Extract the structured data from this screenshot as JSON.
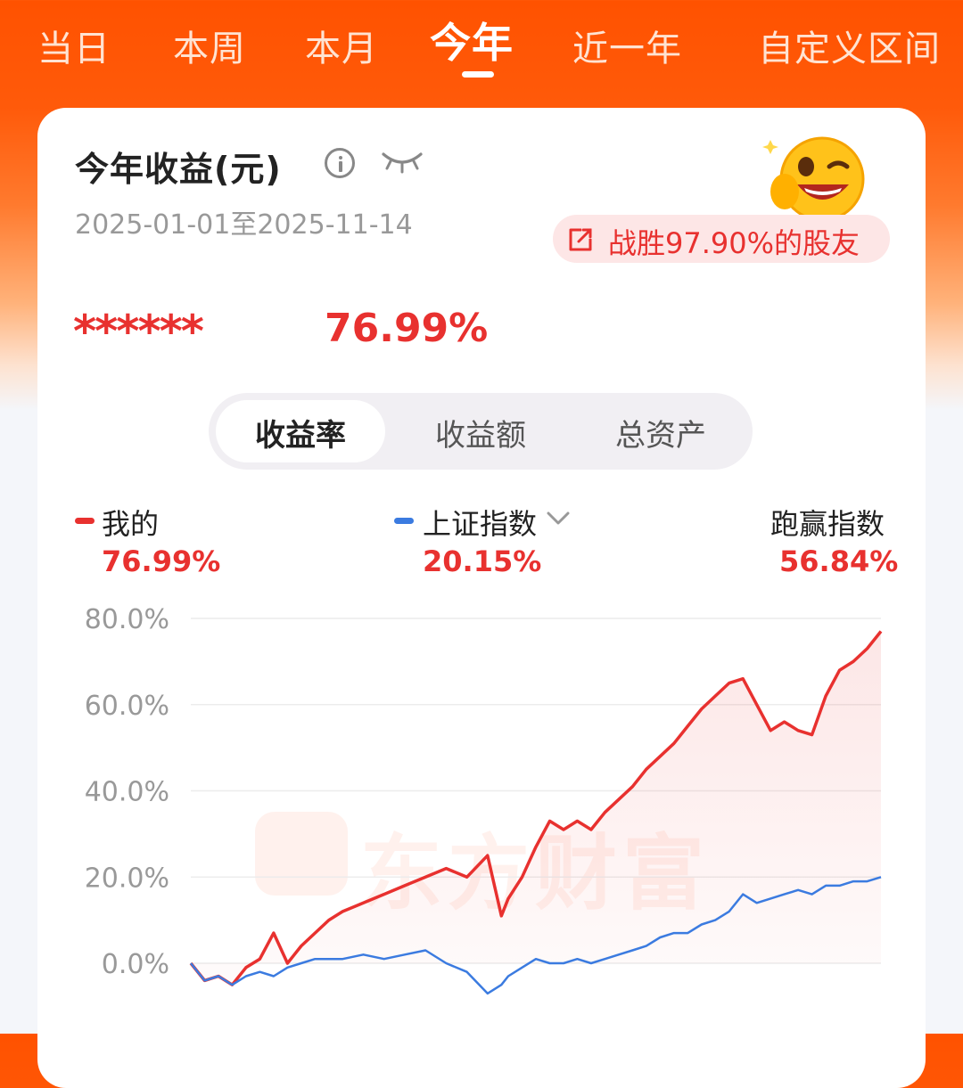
{
  "tabs": [
    {
      "label": "当日"
    },
    {
      "label": "本周"
    },
    {
      "label": "本月"
    },
    {
      "label": "今年",
      "active": true
    },
    {
      "label": "近一年"
    },
    {
      "label": "自定义区间"
    }
  ],
  "card": {
    "title": "今年收益(元)",
    "date_range": "2025-01-01至2025-11-14",
    "badge": "战胜97.90%的股友",
    "masked_amount": "******",
    "total_rate": "76.99%"
  },
  "segments": [
    {
      "label": "收益率",
      "active": true
    },
    {
      "label": "收益额"
    },
    {
      "label": "总资产"
    }
  ],
  "legend": {
    "mine": {
      "label": "我的",
      "value": "76.99%",
      "color": "#e8312f"
    },
    "index": {
      "label": "上证指数",
      "value": "20.15%",
      "color": "#3b7be0"
    },
    "beat": {
      "label": "跑赢指数",
      "value": "56.84%"
    }
  },
  "watermark": "东方财富",
  "chart_data": {
    "type": "line",
    "ylim": [
      0,
      80
    ],
    "y_ticks": [
      "80.0%",
      "60.0%",
      "40.0%",
      "20.0%",
      "0.0%"
    ],
    "grid": true,
    "x_start": "2025-01-01",
    "x_end": "2025-11-14",
    "series": [
      {
        "name": "我的",
        "color": "#e8312f",
        "x": [
          0,
          2,
          4,
          6,
          8,
          10,
          12,
          14,
          15,
          16,
          18,
          20,
          22,
          25,
          28,
          31,
          34,
          37,
          40,
          43,
          45,
          46,
          48,
          50,
          52,
          54,
          56,
          58,
          60,
          62,
          64,
          66,
          68,
          70,
          72,
          74,
          76,
          78,
          80,
          82,
          84,
          86,
          88,
          90,
          92,
          94,
          96,
          98,
          100
        ],
        "values": [
          0,
          -4,
          -3,
          -5,
          -1,
          1,
          7,
          0,
          2,
          4,
          7,
          10,
          12,
          14,
          16,
          18,
          20,
          22,
          20,
          25,
          11,
          15,
          20,
          27,
          33,
          31,
          33,
          31,
          35,
          38,
          41,
          45,
          48,
          51,
          55,
          59,
          62,
          65,
          66,
          60,
          54,
          56,
          54,
          53,
          62,
          68,
          70,
          73,
          77
        ]
      },
      {
        "name": "上证指数",
        "color": "#3b7be0",
        "x": [
          0,
          2,
          4,
          6,
          8,
          10,
          12,
          14,
          16,
          18,
          20,
          22,
          25,
          28,
          31,
          34,
          37,
          40,
          43,
          45,
          46,
          48,
          50,
          52,
          54,
          56,
          58,
          60,
          62,
          64,
          66,
          68,
          70,
          72,
          74,
          76,
          78,
          80,
          82,
          84,
          86,
          88,
          90,
          92,
          94,
          96,
          98,
          100
        ],
        "values": [
          0,
          -4,
          -3,
          -5,
          -3,
          -2,
          -3,
          -1,
          0,
          1,
          1,
          1,
          2,
          1,
          2,
          3,
          0,
          -2,
          -7,
          -5,
          -3,
          -1,
          1,
          0,
          0,
          1,
          0,
          1,
          2,
          3,
          4,
          6,
          7,
          7,
          9,
          10,
          12,
          16,
          14,
          15,
          16,
          17,
          16,
          18,
          18,
          19,
          19,
          20
        ]
      }
    ]
  }
}
